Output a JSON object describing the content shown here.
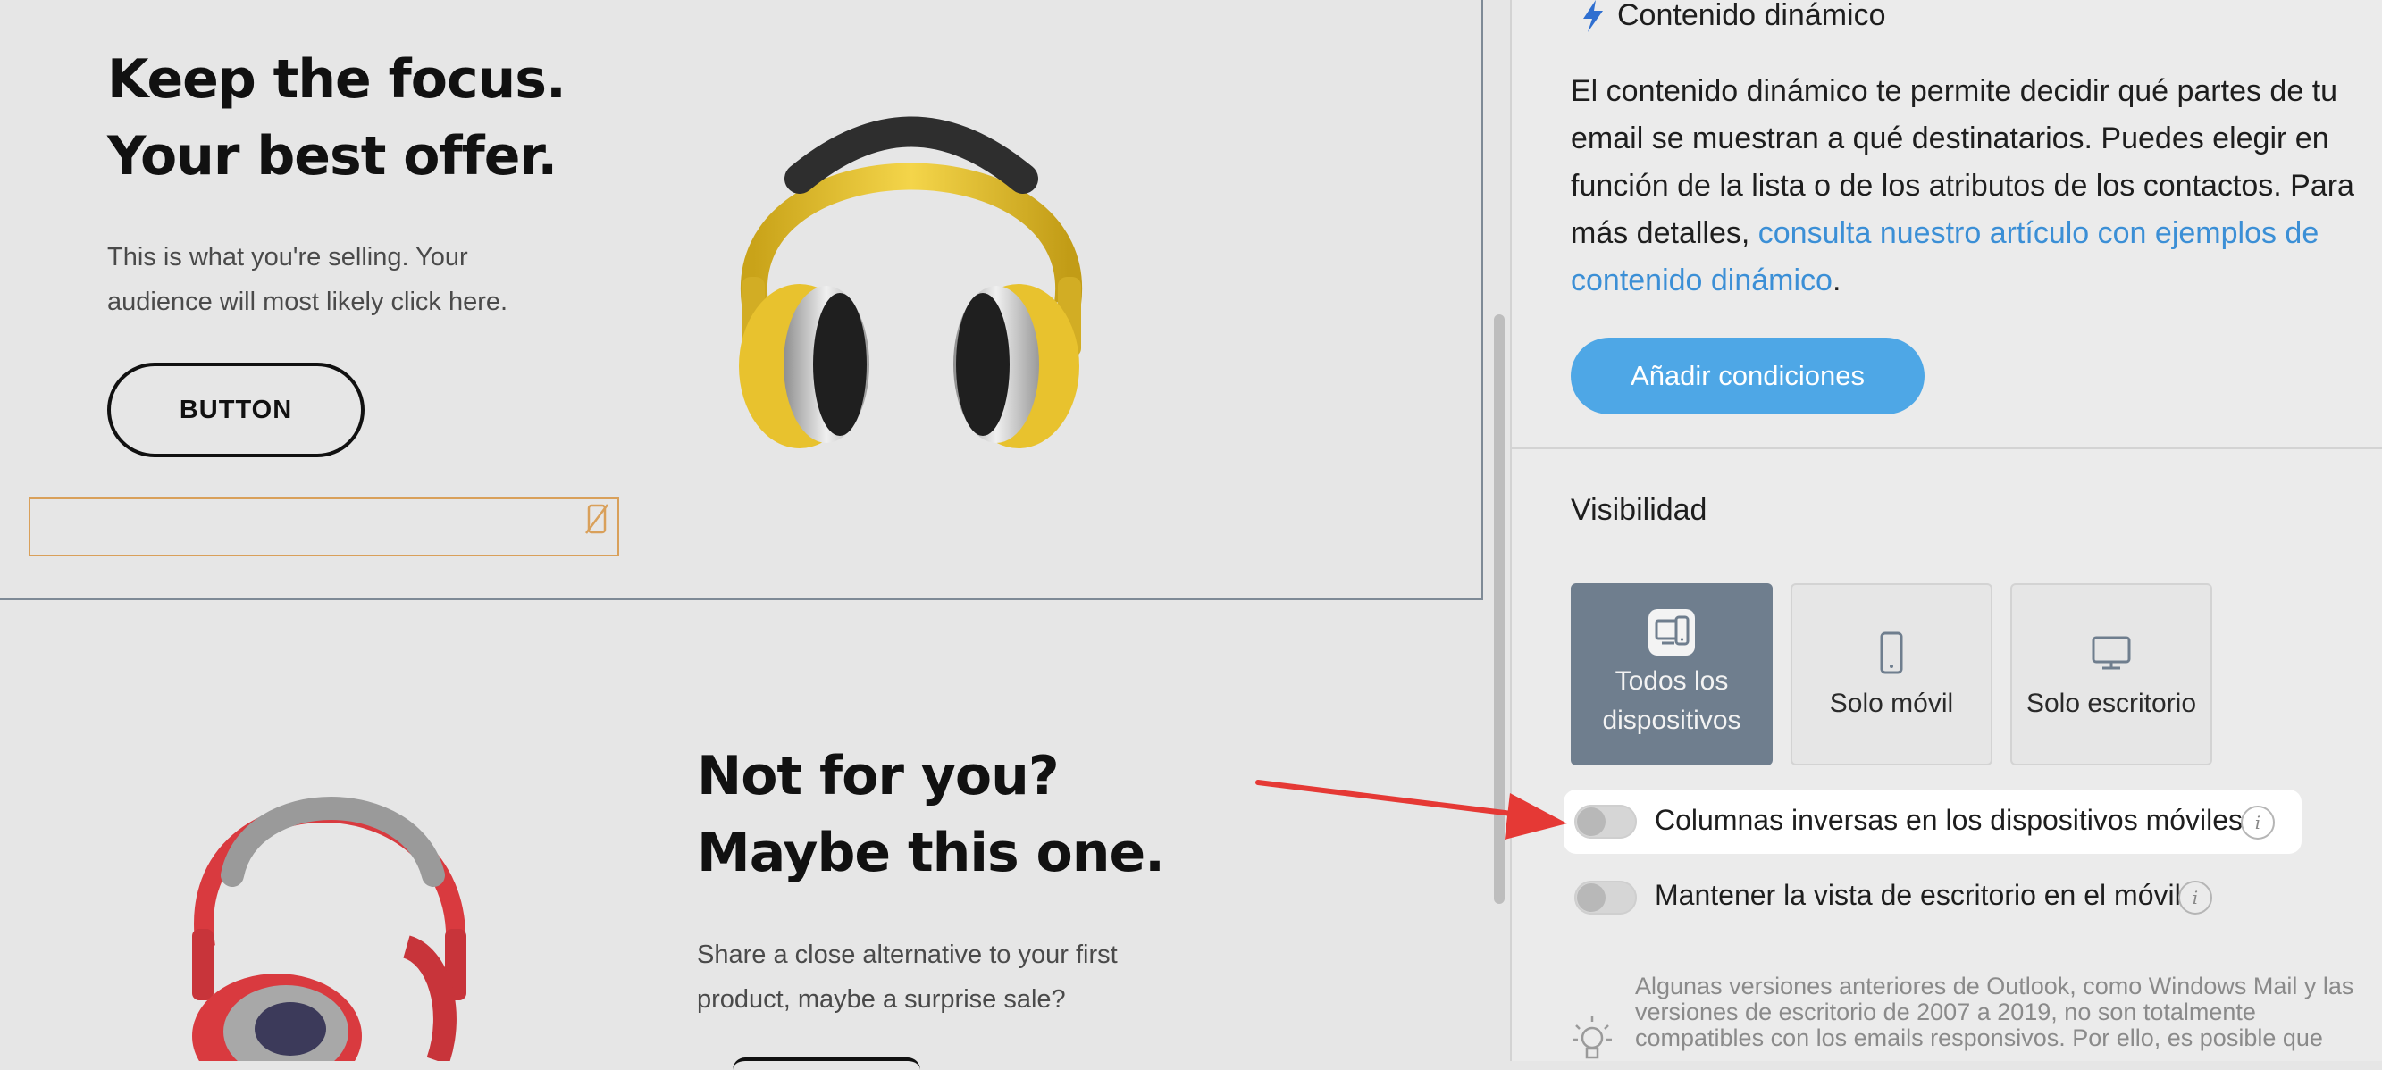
{
  "canvas": {
    "block1": {
      "headline": [
        "Keep the focus.",
        "Your best offer."
      ],
      "body": "This is what you're selling. Your audience will most likely click here.",
      "button": "BUTTON"
    },
    "block2": {
      "headline": [
        "Not for you?",
        "Maybe this one."
      ],
      "body": "Share a close alternative to your first product, maybe a surprise sale?"
    }
  },
  "panel": {
    "dynamic_title": "Contenido dinámico",
    "dynamic_desc_text": "El contenido dinámico te permite decidir qué partes de tu email se muestran a qué destinatarios. Puedes elegir en función de la lista o de los atributos de los contactos. Para más detalles, ",
    "dynamic_desc_link": "consulta nuestro artículo con ejemplos de contenido dinámico",
    "dynamic_desc_end": ".",
    "add_conditions": "Añadir condiciones",
    "visibility_title": "Visibilidad",
    "visibility_options": [
      {
        "label_line1": "Todos los",
        "label_line2": "dispositivos",
        "icon": "devices-icon",
        "selected": true
      },
      {
        "label": "Solo móvil",
        "icon": "mobile-icon",
        "selected": false
      },
      {
        "label": "Solo escritorio",
        "icon": "desktop-icon",
        "selected": false
      }
    ],
    "toggles": [
      {
        "label": "Columnas inversas en los dispositivos móviles",
        "on": false
      },
      {
        "label": "Mantener la vista de escritorio en el móvil",
        "on": false
      }
    ],
    "info_glyph": "i",
    "note": "Algunas versiones anteriores de Outlook, como Windows Mail y las versiones de escritorio de 2007 a 2019, no son totalmente compatibles con los emails responsivos. Por ello, es posible que"
  },
  "colors": {
    "accent_blue": "#4ea7e6",
    "link_blue": "#3b8fd6",
    "selected_card": "#6f7e8e",
    "arrow_red": "#e53935",
    "headphone_yellow": "#e8c22e",
    "headphone_red": "#d93a3f"
  }
}
